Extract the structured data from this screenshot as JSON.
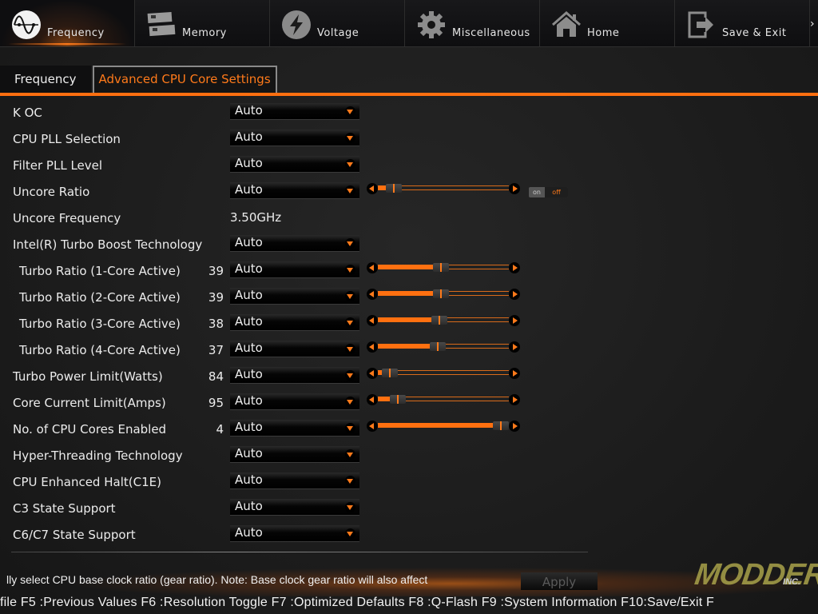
{
  "nav": {
    "tabs": [
      {
        "label": "Frequency",
        "icon": "frequency-icon",
        "active": true
      },
      {
        "label": "Memory",
        "icon": "memory-icon",
        "active": false
      },
      {
        "label": "Voltage",
        "icon": "voltage-icon",
        "active": false
      },
      {
        "label": "Miscellaneous",
        "icon": "gear-icon",
        "active": false
      },
      {
        "label": "Home",
        "icon": "home-icon",
        "active": false
      },
      {
        "label": "Save & Exit",
        "icon": "save-exit-icon",
        "active": false
      }
    ]
  },
  "subtabs": [
    {
      "label": "Frequency",
      "active": false
    },
    {
      "label": "Advanced CPU Core Settings",
      "active": true
    }
  ],
  "settings": [
    {
      "name": "K OC",
      "value": "Auto",
      "type": "dropdown"
    },
    {
      "name": "CPU PLL Selection",
      "value": "Auto",
      "type": "dropdown"
    },
    {
      "name": "Filter PLL Level",
      "value": "Auto",
      "type": "dropdown"
    },
    {
      "name": "Uncore Ratio",
      "value": "Auto",
      "type": "dropdown",
      "slider": 0.12,
      "toggle": {
        "on": "on",
        "off": "off",
        "state": "off"
      }
    },
    {
      "name": "Uncore Frequency",
      "value": "3.50GHz",
      "type": "text"
    },
    {
      "name": "Intel(R) Turbo Boost Technology",
      "value": "Auto",
      "type": "dropdown"
    },
    {
      "name": "Turbo Ratio (1-Core Active)",
      "current": "39",
      "value": "Auto",
      "type": "dropdown",
      "slider": 0.48,
      "indent": true
    },
    {
      "name": "Turbo Ratio (2-Core Active)",
      "current": "39",
      "value": "Auto",
      "type": "dropdown",
      "slider": 0.48,
      "indent": true
    },
    {
      "name": "Turbo Ratio (3-Core Active)",
      "current": "38",
      "value": "Auto",
      "type": "dropdown",
      "slider": 0.47,
      "indent": true
    },
    {
      "name": "Turbo Ratio (4-Core Active)",
      "current": "37",
      "value": "Auto",
      "type": "dropdown",
      "slider": 0.46,
      "indent": true
    },
    {
      "name": "Turbo Power Limit(Watts)",
      "current": "84",
      "value": "Auto",
      "type": "dropdown",
      "slider": 0.09
    },
    {
      "name": "Core Current Limit(Amps)",
      "current": "95",
      "value": "Auto",
      "type": "dropdown",
      "slider": 0.15
    },
    {
      "name": "No. of CPU Cores Enabled",
      "current": "4",
      "value": "Auto",
      "type": "dropdown",
      "slider": 0.94
    },
    {
      "name": "Hyper-Threading Technology",
      "value": "Auto",
      "type": "dropdown"
    },
    {
      "name": "CPU Enhanced Halt(C1E)",
      "value": "Auto",
      "type": "dropdown"
    },
    {
      "name": "C3 State Support",
      "value": "Auto",
      "type": "dropdown"
    },
    {
      "name": "C6/C7 State Support",
      "value": "Auto",
      "type": "dropdown"
    }
  ],
  "footer": {
    "help_text": "lly select CPU base clock ratio (gear ratio). Note: Base clock gear ratio will also affect",
    "apply_label": "Apply",
    "fkeys": "file F5 :Previous Values F6 :Resolution Toggle F7 :Optimized Defaults F8 :Q-Flash F9 :System Information F10:Save/Exit F",
    "watermark": "MODDERS",
    "watermark_sub": "INC."
  },
  "colors": {
    "accent": "#ff6f10",
    "background": "#1c1c1c",
    "text": "#ececec"
  }
}
